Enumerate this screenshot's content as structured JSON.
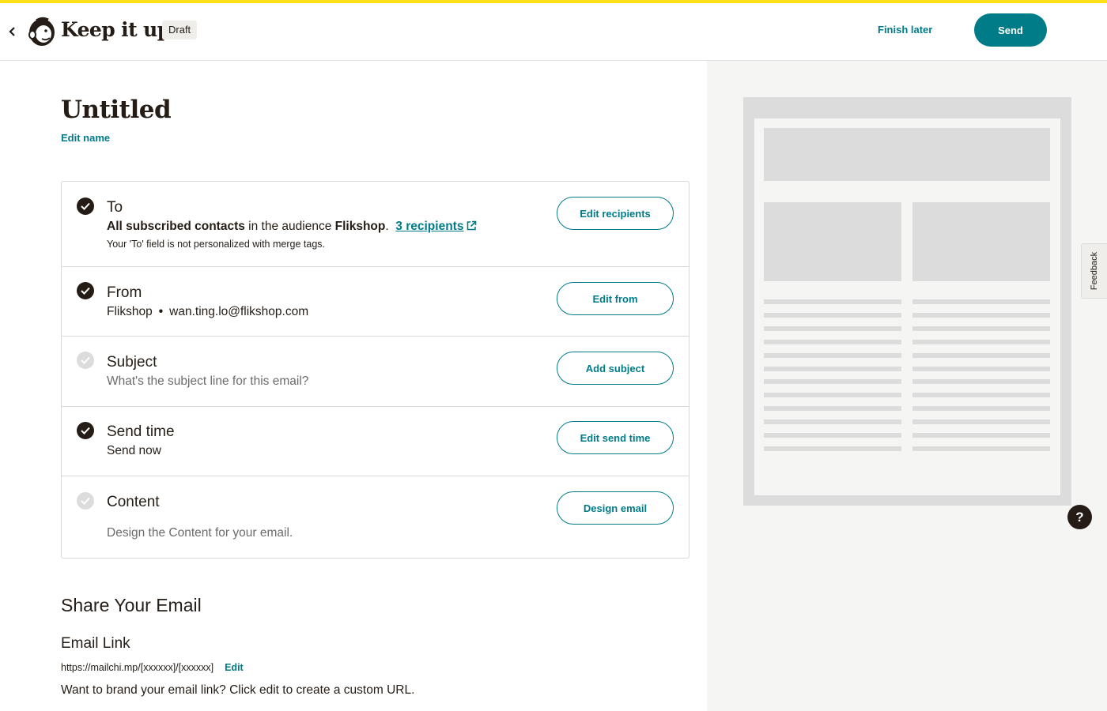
{
  "header": {
    "brand": "Keep it up!",
    "status_badge": "Draft",
    "finish_later": "Finish later",
    "send": "Send"
  },
  "page": {
    "title": "Untitled",
    "edit_name": "Edit name"
  },
  "checklist": {
    "to": {
      "title": "To",
      "segment": "All subscribed contacts",
      "in_audience": "in the audience",
      "audience": "Flikshop",
      "period": ".",
      "recipients_link": "3 recipients",
      "note": "Your 'To' field is not personalized with merge tags.",
      "button": "Edit recipients",
      "complete": true
    },
    "from": {
      "title": "From",
      "name": "Flikshop",
      "separator": "•",
      "email": "wan.ting.lo@flikshop.com",
      "button": "Edit from",
      "complete": true
    },
    "subject": {
      "title": "Subject",
      "description": "What's the subject line for this email?",
      "button": "Add subject",
      "complete": false
    },
    "send_time": {
      "title": "Send time",
      "value": "Send now",
      "button": "Edit send time",
      "complete": true
    },
    "content": {
      "title": "Content",
      "description": "Design the Content for your email.",
      "button": "Design email",
      "complete": false
    }
  },
  "share": {
    "title": "Share Your Email",
    "email_link_title": "Email Link",
    "url": "https://mailchi.mp/[xxxxxx]/[xxxxxx]",
    "edit": "Edit",
    "note": "Want to brand your email link? Click edit to create a custom URL."
  },
  "sidebar": {
    "feedback": "Feedback",
    "help": "?"
  },
  "colors": {
    "accent": "#007c89",
    "top_bar": "#ffe01b",
    "text": "#241c15"
  }
}
